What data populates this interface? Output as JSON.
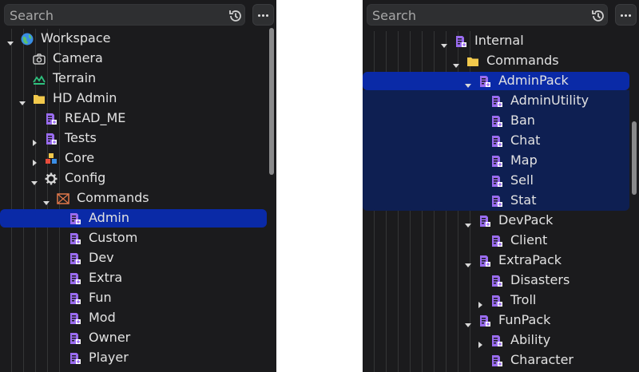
{
  "left": {
    "search_placeholder": "Search",
    "tree": [
      {
        "label": "Workspace",
        "icon": "globe-icon",
        "arrow": "down",
        "depth": 0
      },
      {
        "label": "Camera",
        "icon": "camera-icon",
        "arrow": "none",
        "depth": 1
      },
      {
        "label": "Terrain",
        "icon": "terrain-icon",
        "arrow": "none",
        "depth": 1
      },
      {
        "label": "HD Admin",
        "icon": "folder-icon",
        "arrow": "down",
        "depth": 1
      },
      {
        "label": "READ_ME",
        "icon": "script-icon",
        "arrow": "none",
        "depth": 2
      },
      {
        "label": "Tests",
        "icon": "script-icon",
        "arrow": "right",
        "depth": 2
      },
      {
        "label": "Core",
        "icon": "model-icon",
        "arrow": "right",
        "depth": 2
      },
      {
        "label": "Config",
        "icon": "gear-icon",
        "arrow": "down",
        "depth": 2
      },
      {
        "label": "Commands",
        "icon": "package-icon",
        "arrow": "down",
        "depth": 3
      },
      {
        "label": "Admin",
        "icon": "script-icon",
        "arrow": "none",
        "depth": 4,
        "selected": true
      },
      {
        "label": "Custom",
        "icon": "script-icon",
        "arrow": "none",
        "depth": 4
      },
      {
        "label": "Dev",
        "icon": "script-icon",
        "arrow": "none",
        "depth": 4
      },
      {
        "label": "Extra",
        "icon": "script-icon",
        "arrow": "none",
        "depth": 4
      },
      {
        "label": "Fun",
        "icon": "script-icon",
        "arrow": "none",
        "depth": 4
      },
      {
        "label": "Mod",
        "icon": "script-icon",
        "arrow": "none",
        "depth": 4
      },
      {
        "label": "Owner",
        "icon": "script-icon",
        "arrow": "none",
        "depth": 4
      },
      {
        "label": "Player",
        "icon": "script-icon",
        "arrow": "none",
        "depth": 4
      }
    ]
  },
  "right": {
    "search_placeholder": "Search",
    "tree": [
      {
        "label": "Internal",
        "icon": "script-icon",
        "arrow": "down",
        "depth": 0
      },
      {
        "label": "Commands",
        "icon": "folder-icon",
        "arrow": "down",
        "depth": 1
      },
      {
        "label": "AdminPack",
        "icon": "script-icon",
        "arrow": "down",
        "depth": 2,
        "selected": true
      },
      {
        "label": "AdminUtility",
        "icon": "script-icon",
        "arrow": "none",
        "depth": 3,
        "group": true
      },
      {
        "label": "Ban",
        "icon": "script-icon",
        "arrow": "none",
        "depth": 3,
        "group": true
      },
      {
        "label": "Chat",
        "icon": "script-icon",
        "arrow": "none",
        "depth": 3,
        "group": true
      },
      {
        "label": "Map",
        "icon": "script-icon",
        "arrow": "none",
        "depth": 3,
        "group": true
      },
      {
        "label": "Sell",
        "icon": "script-icon",
        "arrow": "none",
        "depth": 3,
        "group": true
      },
      {
        "label": "Stat",
        "icon": "script-icon",
        "arrow": "none",
        "depth": 3,
        "group": true
      },
      {
        "label": "DevPack",
        "icon": "script-icon",
        "arrow": "down",
        "depth": 2
      },
      {
        "label": "Client",
        "icon": "script-icon",
        "arrow": "none",
        "depth": 3
      },
      {
        "label": "ExtraPack",
        "icon": "script-icon",
        "arrow": "down",
        "depth": 2
      },
      {
        "label": "Disasters",
        "icon": "script-icon",
        "arrow": "none",
        "depth": 3
      },
      {
        "label": "Troll",
        "icon": "script-icon",
        "arrow": "right",
        "depth": 3
      },
      {
        "label": "FunPack",
        "icon": "script-icon",
        "arrow": "down",
        "depth": 2
      },
      {
        "label": "Ability",
        "icon": "script-icon",
        "arrow": "right",
        "depth": 3
      },
      {
        "label": "Character",
        "icon": "script-icon",
        "arrow": "none",
        "depth": 3
      }
    ]
  },
  "colors": {
    "panel_bg": "#1b1b1d",
    "selection": "#0a2aa7",
    "selection_group": "#0e1f52",
    "script_purple": "#9a6cf0",
    "folder_yellow": "#f2c94c",
    "text": "#e2e2e2"
  }
}
